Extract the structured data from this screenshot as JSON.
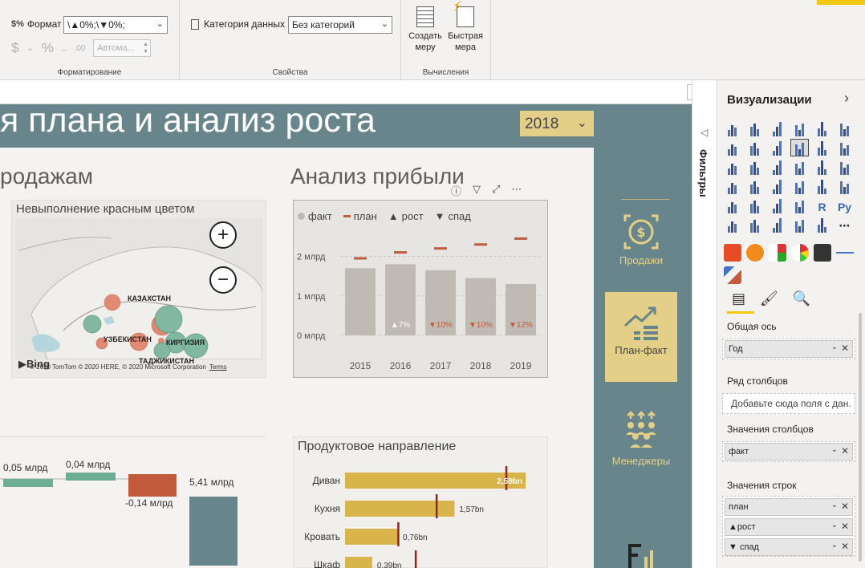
{
  "ribbon": {
    "format_label": "Формат",
    "format_value": "\\▲0%;\\▼0%;",
    "auto_label": "Автома...",
    "group_formatting": "Форматирование",
    "data_category_label": "Категория данных",
    "data_category_value": "Без категорий",
    "group_properties": "Свойства",
    "create_measure": "Создать меру",
    "quick_measure": "Быстрая мера",
    "group_calculations": "Вычисления"
  },
  "report": {
    "title": "я плана и анализ роста",
    "year": "2018",
    "sales_title": "родажам",
    "profit_title": "Анализ прибыли",
    "map_title": "Невыполнение красным цветом",
    "map_countries": [
      "КАЗАХСТАН",
      "УЗБЕКИСТАН",
      "КИРГИЗИЯ",
      "ТАДЖИКИСТАН"
    ],
    "map_copyright": "© 2020 TomTom © 2020 HERE, © 2020 Microsoft Corporation",
    "map_terms": "Terms",
    "bing": "Bing",
    "product_title": "Продуктовое направление"
  },
  "nav": {
    "sales": "Продажи",
    "plan_fact": "План-факт",
    "managers": "Менеджеры"
  },
  "chart_data": [
    {
      "type": "bar",
      "title": "",
      "legend": [
        "факт",
        "план",
        "рост",
        "спад"
      ],
      "categories": [
        "2015",
        "2016",
        "2017",
        "2018",
        "2019"
      ],
      "y_ticks": [
        "0 млрд",
        "1 млрд",
        "2 млрд"
      ],
      "ylim": [
        0,
        2.6
      ],
      "series": [
        {
          "name": "факт",
          "values": [
            1.7,
            1.8,
            1.65,
            1.45,
            1.3
          ]
        },
        {
          "name": "план",
          "values": [
            1.95,
            2.1,
            2.2,
            2.3,
            2.45
          ]
        }
      ],
      "labels": [
        "",
        "▲7%",
        "▼10%",
        "▼10%",
        "▼12%"
      ]
    },
    {
      "type": "bar",
      "title": "",
      "orientation": "horizontal",
      "categories": [
        "Диван",
        "Кухня",
        "Кровать",
        "Шкаф"
      ],
      "values": [
        2.59,
        1.57,
        0.76,
        0.39
      ],
      "value_labels": [
        "2,59bn",
        "1,57bn",
        "0,76bn",
        "0,39bn"
      ],
      "targets": [
        2.3,
        1.3,
        0.75,
        1.0
      ]
    },
    {
      "type": "bar",
      "title": "",
      "subtype": "waterfall",
      "value_labels": [
        "0,05 млрд",
        "0,04 млрд",
        "-0,14 млрд",
        "5,41 млрд"
      ],
      "values": [
        0.05,
        0.04,
        -0.14,
        5.41
      ]
    }
  ],
  "viz": {
    "header": "Визуализации",
    "filters": "Фильтры",
    "shared_axis_label": "Общая ось",
    "shared_axis_value": "Год",
    "column_series_label": "Ряд столбцов",
    "column_series_placeholder": "Добавьте сюда поля с дан...",
    "column_values_label": "Значения столбцов",
    "column_values_value": "факт",
    "row_values_label": "Значения строк",
    "row_values": [
      "план",
      "▲рост",
      "▼ спад"
    ]
  },
  "colors": {
    "teal": "#67858b",
    "gold": "#e3cf88",
    "bar_fact": "#c0bab4",
    "plan": "#c25a3b",
    "product_bar": "#d9b44a"
  }
}
